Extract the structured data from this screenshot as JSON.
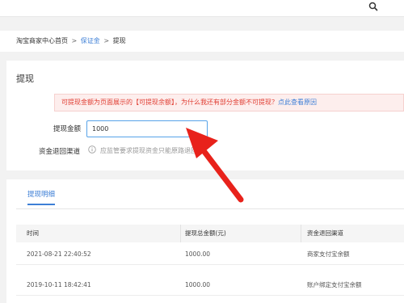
{
  "topbar": {
    "search_icon": "search-icon"
  },
  "breadcrumb": {
    "home": "淘宝商家中心首页",
    "separator1": ">",
    "deposit": "保证金",
    "separator2": ">",
    "current": "提现"
  },
  "withdraw_panel": {
    "title": "提现",
    "notice_text": "可提现金额为页面展示的【可提现余额】，为什么我还有部分金额不可提现？",
    "notice_link": "点此查看原因",
    "amount_label": "提现金额",
    "amount_value": "1000",
    "channel_label": "资金退回渠道",
    "channel_text": "应监管要求提现资金只能原路退回"
  },
  "details": {
    "tab_label": "提现明细",
    "columns": [
      "时间",
      "提现总金额(元)",
      "资金退回渠道"
    ],
    "rows": [
      {
        "time": "2021-08-21 22:40:52",
        "amount": "1000.00",
        "channel": "商家支付宝余额"
      },
      {
        "time": "2019-10-11 18:42:41",
        "amount": "1000.00",
        "channel": "账户绑定支付宝余额"
      }
    ]
  },
  "colors": {
    "accent": "#3d7fd6",
    "warning_text": "#e03c31",
    "arrow": "#e8221b"
  }
}
